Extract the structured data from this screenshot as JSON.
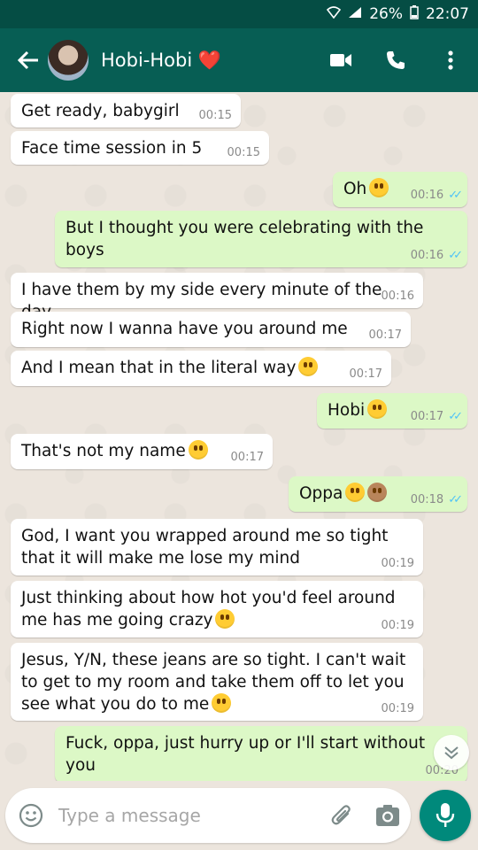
{
  "status_bar": {
    "battery": "26%",
    "time": "22:07"
  },
  "header": {
    "contact_name": "Hobi-Hobi ❤️"
  },
  "messages": [
    {
      "dir": "in",
      "text": "Get ready, babygirl",
      "time": "00:15"
    },
    {
      "dir": "in",
      "text": "Face time session in 5",
      "time": "00:15"
    },
    {
      "dir": "out",
      "text": "Oh",
      "emoji": [
        "flushed"
      ],
      "time": "00:16"
    },
    {
      "dir": "out",
      "text": "But I thought you were celebrating with the boys",
      "time": "00:16"
    },
    {
      "dir": "in",
      "text": "I have them by my side every minute of the day",
      "time": "00:16"
    },
    {
      "dir": "in",
      "text": "Right now I wanna have you around me",
      "time": "00:17"
    },
    {
      "dir": "in",
      "text": "And I mean that in the literal way",
      "emoji": [
        "tired"
      ],
      "time": "00:17"
    },
    {
      "dir": "out",
      "text": "Hobi",
      "emoji": [
        "flushed"
      ],
      "time": "00:17"
    },
    {
      "dir": "in",
      "text": "That's not my name",
      "emoji": [
        "smirk"
      ],
      "time": "00:17"
    },
    {
      "dir": "out",
      "text": "Oppa",
      "emoji": [
        "persevere",
        "see-no-evil-monkey"
      ],
      "time": "00:18"
    },
    {
      "dir": "in",
      "text": "God, I want you wrapped around me so tight that it will make me lose my mind",
      "time": "00:19"
    },
    {
      "dir": "in",
      "text": "Just thinking about how hot you'd feel around me has me going crazy",
      "emoji": [
        "persevere"
      ],
      "time": "00:19"
    },
    {
      "dir": "in",
      "text": "Jesus, Y/N, these jeans are so tight. I can't wait to get to my room and take them off to let you see what you do to me",
      "emoji": [
        "tired"
      ],
      "time": "00:19"
    },
    {
      "dir": "out",
      "text": "Fuck, oppa, just hurry up or I'll start without you",
      "time": "00:20"
    }
  ],
  "input": {
    "placeholder": "Type a message"
  },
  "colors": {
    "header": "#075e54",
    "statusbar": "#054d44",
    "outgoing": "#dcf8c6",
    "incoming": "#ffffff",
    "fab": "#00897b",
    "ticks": "#4fc3f7"
  },
  "icons": [
    "back-arrow-icon",
    "video-call-icon",
    "phone-icon",
    "more-vert-icon",
    "emoji-icon",
    "attach-icon",
    "camera-icon",
    "mic-icon",
    "scroll-down-icon"
  ]
}
